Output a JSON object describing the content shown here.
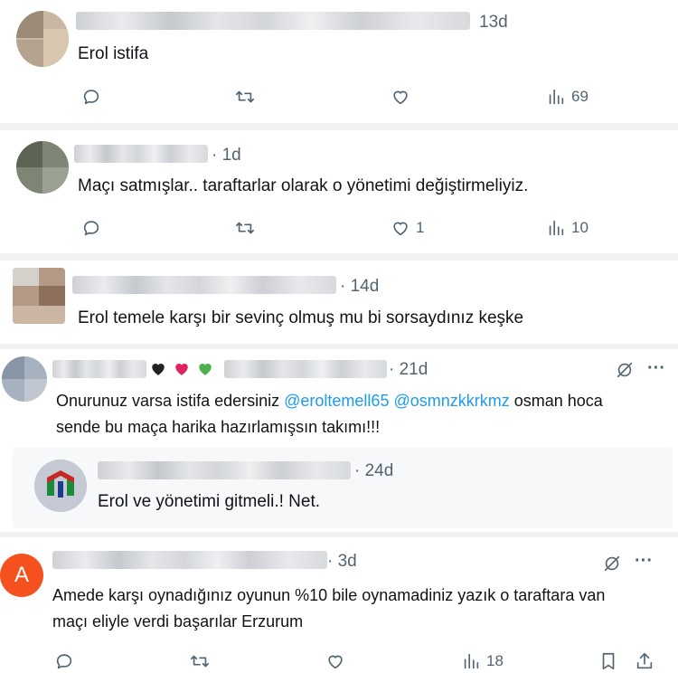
{
  "tweets": [
    {
      "time": "13d",
      "text": "Erol istifa",
      "replies": "",
      "retweets": "",
      "likes": "",
      "views": "69"
    },
    {
      "time": "· 1d",
      "text": "Maçı satmışlar.. taraftarlar olarak o yönetimi değiştirmeliyiz.",
      "likes": "1",
      "views": "10"
    },
    {
      "time": "· 14d",
      "text": "Erol temele karşı bir sevinç olmuş mu bi sorsaydınız keşke"
    },
    {
      "time": "· 21d",
      "text_line1_pre": "Onurunuz varsa istifa edersiniz ",
      "mention1": "@eroltemell65",
      "mention2": "@osmnzkkrkmz",
      "text_line1_post": " osman hoca",
      "text_line2": "sende bu maça harika hazırlamışsın takımı!!!",
      "more": "···"
    },
    {
      "time": "· 24d",
      "text": "Erol ve yönetimi gitmeli.! Net."
    },
    {
      "avatar_letter": "A",
      "time": "· 3d",
      "text_line1": "Amede karşı oynadığınız oyunun %10 bile oynamadiniz yazık o taraftara van",
      "text_line2": "maçı eliyle verdi başarılar Erzurum",
      "views": "18",
      "more": "···"
    }
  ],
  "colors": {
    "text": "#0f1419",
    "muted": "#536471",
    "link": "#1d9bf0",
    "avatar_A": "#f4511e",
    "separator": "#f0f2f4"
  }
}
